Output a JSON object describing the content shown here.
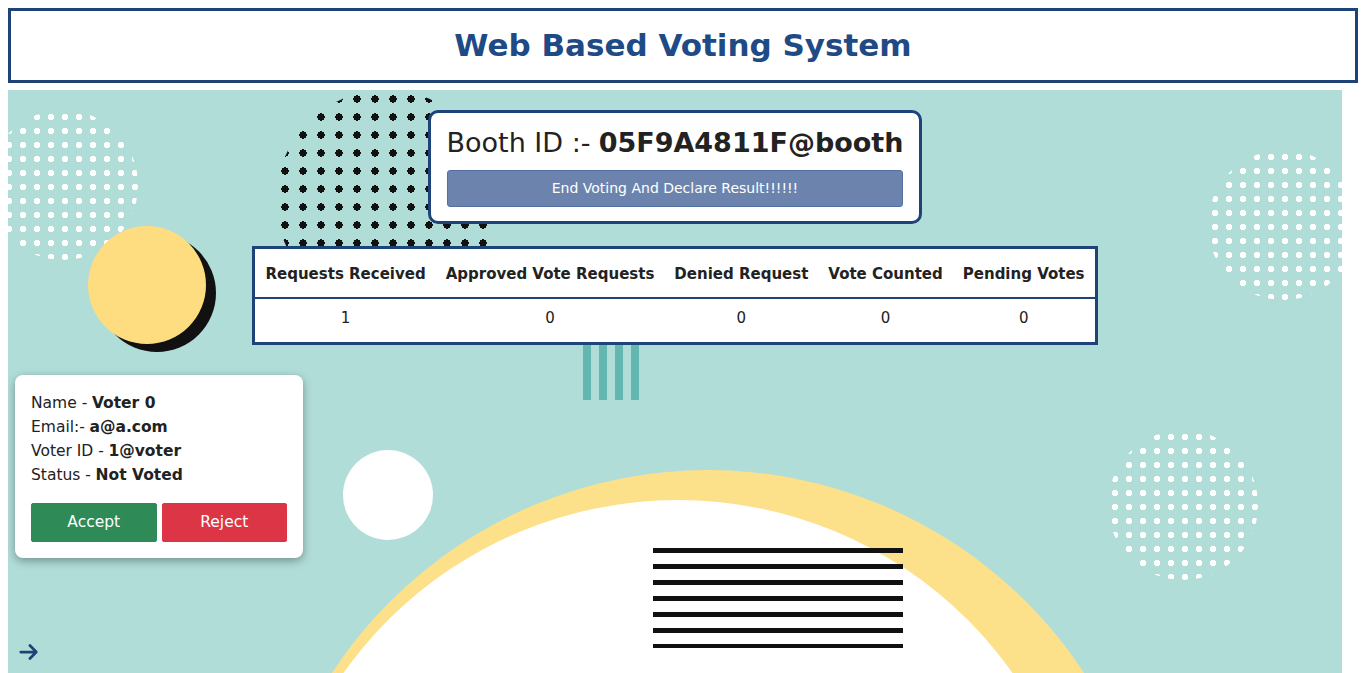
{
  "header": {
    "title": "Web Based Voting System"
  },
  "booth": {
    "label": "Booth ID :-",
    "id": "05F9A4811F@booth",
    "end_button": "End Voting And Declare Result!!!!!!"
  },
  "stats": {
    "columns": [
      "Requests Received",
      "Approved Vote Requests",
      "Denied Request",
      "Vote Counted",
      "Pending Votes"
    ],
    "values": [
      "1",
      "0",
      "0",
      "0",
      "0"
    ]
  },
  "voters": [
    {
      "fields": [
        {
          "label": "Name -",
          "value": "Voter 0"
        },
        {
          "label": "Email:-",
          "value": "a@a.com"
        },
        {
          "label": "Voter ID -",
          "value": "1@voter"
        },
        {
          "label": "Status -",
          "value": "Not Voted"
        }
      ],
      "accept": "Accept",
      "reject": "Reject"
    }
  ]
}
